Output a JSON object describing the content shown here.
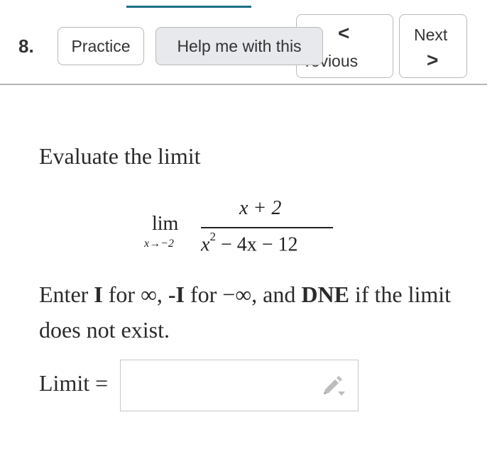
{
  "question": {
    "number": "8."
  },
  "buttons": {
    "practice": "Practice",
    "help": "Help me with this",
    "previous": "Previous",
    "previous_visible": "revious",
    "next": "Next",
    "prev_chevron": "<",
    "next_chevron": ">"
  },
  "problem": {
    "intro": "Evaluate the limit",
    "lim_word": "lim",
    "lim_sub": "x→−2",
    "numerator": "x + 2",
    "denominator_base": "x",
    "denominator_exp": "2",
    "denominator_rest": " − 4x − 12"
  },
  "instructions": {
    "part1": "Enter ",
    "i_bold": "I",
    "part2": " for ∞, ",
    "neg_i_bold": "-I",
    "part3": " for −∞, and ",
    "dne_bold": "DNE",
    "part4": " if the limit does not exist."
  },
  "answer": {
    "label": "Limit =",
    "value": "",
    "placeholder": ""
  },
  "icons": {
    "edit": "pencil-icon"
  },
  "colors": {
    "accent": "#1c6f86",
    "help_bg": "#e7e9ec",
    "border": "#b9b9b9",
    "icon": "#bdbdbd"
  }
}
